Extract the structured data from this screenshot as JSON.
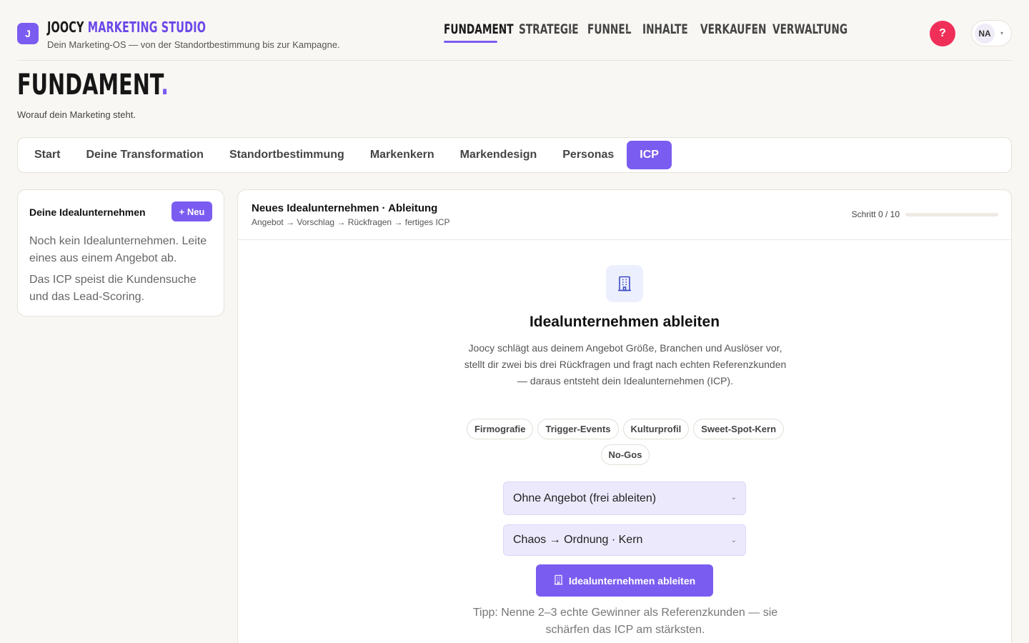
{
  "header": {
    "logo_letter": "J",
    "brand_part1": "JOOCY",
    "brand_part2": "MARKETING STUDIO",
    "tagline": "Dein Marketing-OS — von der Standortbestimmung bis zur Kampagne.",
    "nav": [
      {
        "label": "FUNDAMENT",
        "active": true
      },
      {
        "label": "STRATEGIE",
        "active": false
      },
      {
        "label": "FUNNEL",
        "active": false
      },
      {
        "label": "INHALTE",
        "active": false
      },
      {
        "label": "VERKAUFEN",
        "active": false
      },
      {
        "label": "VERWALTUNG",
        "active": false
      }
    ],
    "help_label": "?",
    "user_initials": "NA"
  },
  "page": {
    "title": "FUNDAMENT",
    "title_dot": ".",
    "subtitle": "Worauf dein Marketing steht."
  },
  "tabs": [
    {
      "label": "Start",
      "active": false
    },
    {
      "label": "Deine Transformation",
      "active": false
    },
    {
      "label": "Standortbestimmung",
      "active": false
    },
    {
      "label": "Markenkern",
      "active": false
    },
    {
      "label": "Markendesign",
      "active": false
    },
    {
      "label": "Personas",
      "active": false
    },
    {
      "label": "ICP",
      "active": true
    }
  ],
  "sidebar": {
    "title": "Deine Idealunternehmen",
    "new_button": "+ Neu",
    "empty_text_1": "Noch kein Idealunternehmen. Leite eines aus einem Angebot ab.",
    "empty_text_2": "Das ICP speist die Kundensuche und das Lead-Scoring."
  },
  "main": {
    "title": "Neues Idealunternehmen · Ableitung",
    "steps_path": "Angebot → Vorschlag → Rückfragen → fertiges ICP",
    "step_label": "Schritt 0 / 10",
    "progress_fraction": 0,
    "hero_icon": "building-icon",
    "hero_title": "Idealunternehmen ableiten",
    "hero_description": "Joocy schlägt aus deinem Angebot Größe, Branchen und Auslöser vor, stellt dir zwei bis drei Rückfragen und fragt nach echten Referenzkunden — daraus entsteht dein Idealunternehmen (ICP).",
    "chips": [
      "Firmografie",
      "Trigger-Events",
      "Kulturprofil",
      "Sweet-Spot-Kern",
      "No-Gos"
    ],
    "offer_select": "Ohne Angebot (frei ableiten)",
    "transformation_select": "Chaos → Ordnung · Kern",
    "derive_button": "Idealunternehmen ableiten",
    "tip": "Tipp: Nenne 2–3 echte Gewinner als Referenzkunden — sie schärfen das ICP am stärksten."
  },
  "colors": {
    "accent": "#7b5cf0",
    "help": "#f02f59",
    "background": "#f9f7f3"
  }
}
